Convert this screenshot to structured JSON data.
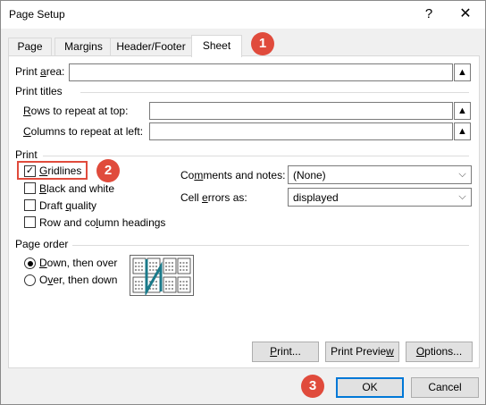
{
  "window": {
    "title": "Page Setup",
    "help_label": "?",
    "close_label": "✕"
  },
  "tabs": [
    {
      "label": "Page"
    },
    {
      "label": "Margins"
    },
    {
      "label": "Header/Footer"
    },
    {
      "label": "Sheet",
      "active": true
    }
  ],
  "sheet": {
    "print_area": {
      "prefix": "Print ",
      "hotkey": "a",
      "suffix": "rea:",
      "value": ""
    },
    "print_titles": {
      "heading": "Print titles",
      "rows": {
        "hotkey": "R",
        "suffix": "ows to repeat at top:",
        "value": ""
      },
      "columns": {
        "hotkey": "C",
        "suffix": "olumns to repeat at left:",
        "value": ""
      }
    },
    "print": {
      "heading": "Print",
      "gridlines": {
        "hotkey": "G",
        "suffix": "ridlines",
        "checked": true
      },
      "black_white": {
        "hotkey": "B",
        "suffix": "lack and white",
        "checked": false
      },
      "draft": {
        "prefix": "Draft ",
        "hotkey": "q",
        "suffix": "uality",
        "checked": false
      },
      "headings": {
        "prefix": "Row and co",
        "hotkey": "l",
        "suffix": "umn headings",
        "checked": false
      },
      "comments": {
        "prefix": "Co",
        "hotkey": "m",
        "suffix": "ments and notes:",
        "value": "(None)"
      },
      "cell_errors": {
        "prefix": "Cell ",
        "hotkey": "e",
        "suffix": "rrors as:",
        "value": "displayed"
      }
    },
    "page_order": {
      "heading": "Page order",
      "down_then_over": {
        "hotkey": "D",
        "suffix": "own, then over",
        "selected": true
      },
      "over_then_down": {
        "prefix": "O",
        "hotkey": "v",
        "suffix": "er, then down",
        "selected": false
      }
    }
  },
  "buttons": {
    "print": {
      "hotkey": "P",
      "suffix": "rint..."
    },
    "print_preview": {
      "prefix": "Print Previe",
      "hotkey": "w",
      "suffix": ""
    },
    "options": {
      "hotkey": "O",
      "suffix": "ptions..."
    },
    "ok": "OK",
    "cancel": "Cancel"
  },
  "callouts": [
    "1",
    "2",
    "3"
  ],
  "icons": {
    "collapse": "up-arrow-icon",
    "dropdown": "chevron-down-icon",
    "check": "✓"
  },
  "colors": {
    "callout": "#e04b3c",
    "default_button": "#0078d7"
  }
}
